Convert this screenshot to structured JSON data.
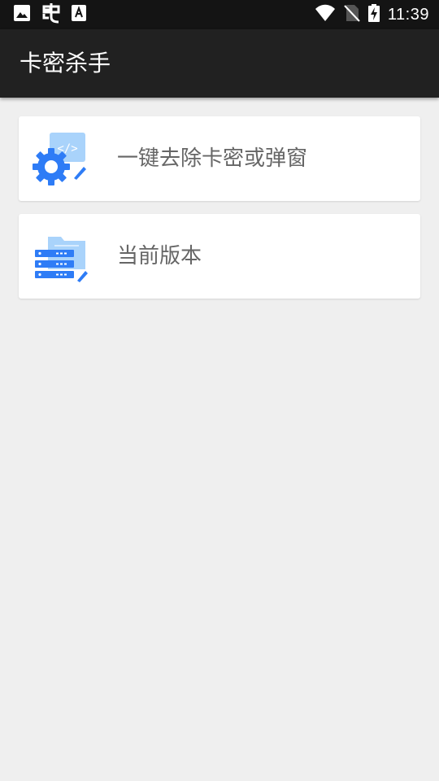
{
  "status_bar": {
    "time": "11:39",
    "left_icons": [
      "image-icon",
      "bug-icon",
      "text-a-icon"
    ],
    "right_icons": [
      "wifi-icon",
      "no-sim-icon",
      "battery-charging-icon"
    ]
  },
  "app_bar": {
    "title": "卡密杀手"
  },
  "menu": {
    "items": [
      {
        "label": "一键去除卡密或弹窗",
        "icon": "code-settings-icon"
      },
      {
        "label": "当前版本",
        "icon": "server-folder-icon"
      }
    ]
  },
  "colors": {
    "status_bar_bg": "#141414",
    "app_bar_bg": "#212121",
    "page_bg": "#efefef",
    "card_bg": "#ffffff",
    "label_text": "#666666",
    "icon_blue": "#2e7cf6"
  }
}
